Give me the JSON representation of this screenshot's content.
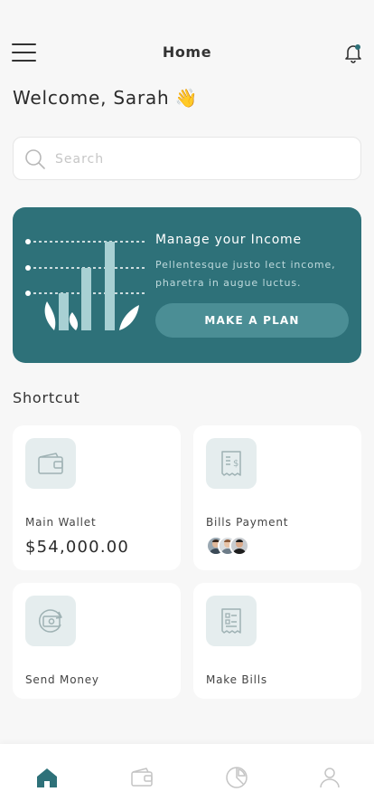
{
  "header": {
    "title": "Home",
    "menu_icon": "hamburger-menu-icon",
    "notification_icon": "bell-icon",
    "notification_dot_color": "#2e7179"
  },
  "welcome": {
    "text": "Welcome, Sarah",
    "emoji": "👋"
  },
  "search": {
    "placeholder": "Search",
    "value": ""
  },
  "banner": {
    "title": "Manage your Income",
    "description": "Pellentesque justo lect income, pharetra in augue luctus.",
    "button_label": "MAKE A PLAN",
    "color": "#2e7179"
  },
  "shortcut": {
    "title": "Shortcut",
    "cards": [
      {
        "label": "Main Wallet",
        "amount": "$54,000.00",
        "icon": "wallet-icon"
      },
      {
        "label": "Bills Payment",
        "icon": "receipt-icon"
      },
      {
        "label": "Send Money",
        "icon": "money-transfer-icon"
      },
      {
        "label": "Make Bills",
        "icon": "bill-document-icon"
      }
    ]
  },
  "bottom_nav": {
    "items": [
      {
        "icon": "home-icon",
        "active": true
      },
      {
        "icon": "wallet-icon",
        "active": false
      },
      {
        "icon": "pie-chart-icon",
        "active": false
      },
      {
        "icon": "profile-icon",
        "active": false
      }
    ],
    "active_color": "#2e7179",
    "inactive_color": "#c4c4c4"
  }
}
